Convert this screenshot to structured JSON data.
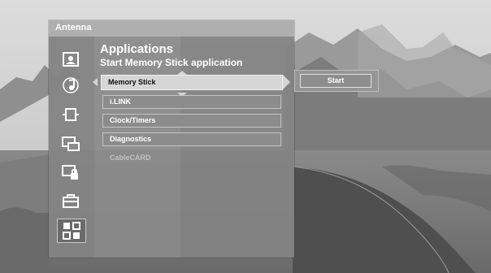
{
  "panel": {
    "title": "Antenna"
  },
  "main": {
    "heading": "Applications",
    "subheading": "Start Memory Stick application"
  },
  "categories": [
    {
      "name": "photo-icon",
      "selected": false
    },
    {
      "name": "music-icon",
      "selected": false
    },
    {
      "name": "video-icon",
      "selected": false
    },
    {
      "name": "tv-channel-icon",
      "selected": false
    },
    {
      "name": "parental-lock-icon",
      "selected": false
    },
    {
      "name": "toolbox-icon",
      "selected": false
    },
    {
      "name": "applications-icon",
      "selected": true
    }
  ],
  "menu": {
    "items": [
      {
        "label": "Memory Stick",
        "state": "highlighted"
      },
      {
        "label": "i.LINK",
        "state": "normal"
      },
      {
        "label": "Clock/Timers",
        "state": "normal"
      },
      {
        "label": "Diagnostics",
        "state": "normal"
      },
      {
        "label": "CableCARD",
        "state": "disabled"
      }
    ]
  },
  "popup": {
    "start_label": "Start"
  },
  "colors": {
    "panel": "#8a8a8a",
    "highlight": "#d6d6d6",
    "text": "#ffffff"
  }
}
